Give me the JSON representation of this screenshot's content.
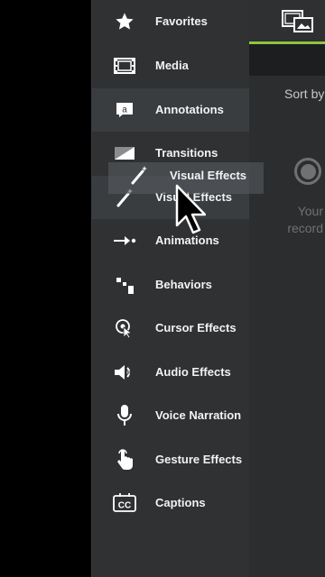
{
  "sidebar": {
    "items": [
      {
        "label": "Favorites",
        "icon": "star-icon"
      },
      {
        "label": "Media",
        "icon": "film-icon"
      },
      {
        "label": "Annotations",
        "icon": "annotation-icon"
      },
      {
        "label": "Transitions",
        "icon": "transition-icon"
      },
      {
        "label": "Visual Effects",
        "icon": "magic-wand-icon"
      },
      {
        "label": "Animations",
        "icon": "animation-arrow-icon"
      },
      {
        "label": "Behaviors",
        "icon": "behaviors-icon"
      },
      {
        "label": "Cursor Effects",
        "icon": "cursor-effects-icon"
      },
      {
        "label": "Audio Effects",
        "icon": "speaker-icon"
      },
      {
        "label": "Voice Narration",
        "icon": "microphone-icon"
      },
      {
        "label": "Gesture Effects",
        "icon": "hand-gesture-icon"
      },
      {
        "label": "Captions",
        "icon": "captions-icon"
      }
    ]
  },
  "drag_ghost": {
    "label": "Visual Effects",
    "icon": "magic-wand-icon"
  },
  "right_panel": {
    "sort_label": "Sort by",
    "hint_line1": "Your",
    "hint_line2": "record"
  },
  "colors": {
    "sidebar_bg": "#2f3133",
    "accent_green": "#8dc63f",
    "text": "#f2f2f2",
    "muted_text": "#6f7173"
  }
}
